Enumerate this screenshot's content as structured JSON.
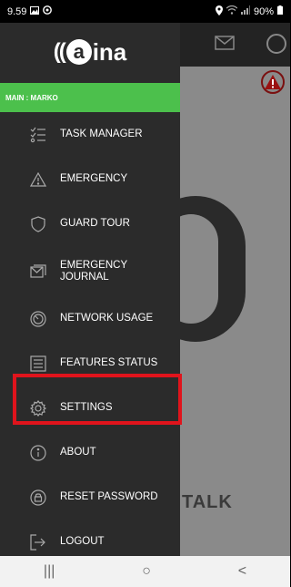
{
  "status": {
    "time": "9.59",
    "battery": "90%"
  },
  "brand": {
    "waves": "((",
    "a": "a",
    "rest": "ina"
  },
  "main_label": "MAIN : MARKO",
  "menu": [
    {
      "label": "TASK MANAGER",
      "icon": "checklist-icon"
    },
    {
      "label": "EMERGENCY",
      "icon": "warning-icon"
    },
    {
      "label": "GUARD TOUR",
      "icon": "shield-icon"
    },
    {
      "label": "EMERGENCY JOURNAL",
      "icon": "journal-icon"
    },
    {
      "label": "NETWORK USAGE",
      "icon": "gauge-icon"
    },
    {
      "label": "FEATURES STATUS",
      "icon": "list-icon"
    },
    {
      "label": "SETTINGS",
      "icon": "gear-icon"
    },
    {
      "label": "ABOUT",
      "icon": "info-icon"
    },
    {
      "label": "RESET PASSWORD",
      "icon": "lock-icon"
    },
    {
      "label": "LOGOUT",
      "icon": "logout-icon"
    }
  ],
  "background": {
    "talk": "TALK"
  },
  "nav": {
    "recents": "|||",
    "home": "○",
    "back": "<"
  }
}
